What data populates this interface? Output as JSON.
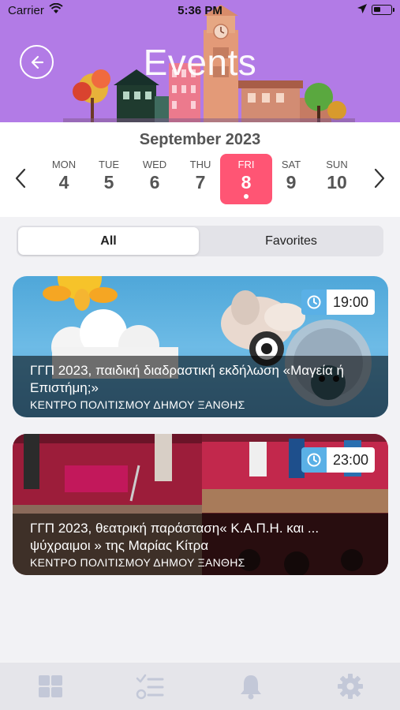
{
  "status": {
    "carrier": "Carrier",
    "time": "5:36 PM"
  },
  "header": {
    "title": "Events"
  },
  "calendar": {
    "month": "September 2023",
    "days": [
      {
        "name": "MON",
        "num": "4"
      },
      {
        "name": "TUE",
        "num": "5"
      },
      {
        "name": "WED",
        "num": "6"
      },
      {
        "name": "THU",
        "num": "7"
      },
      {
        "name": "FRI",
        "num": "8"
      },
      {
        "name": "SAT",
        "num": "9"
      },
      {
        "name": "SUN",
        "num": "10"
      }
    ],
    "selected_index": 4
  },
  "filter": {
    "all": "All",
    "favorites": "Favorites",
    "selected": "All"
  },
  "events": [
    {
      "time": "19:00",
      "title": "ΓΓΠ 2023, παιδική διαδραστική εκδήλωση «Μαγεία ή Επιστήμη;»",
      "venue": "ΚΕΝΤΡΟ ΠΟΛΙΤΙΣΜΟΥ ΔΗΜΟΥ ΞΑΝΘΗΣ"
    },
    {
      "time": "23:00",
      "title": "ΓΓΠ 2023, θεατρική παράσταση« Κ.Α.Π.Η. και ... ψύχραιμοι » της Μαρίας Κίτρα",
      "venue": "ΚΕΝΤΡΟ ΠΟΛΙΤΙΣΜΟΥ ΔΗΜΟΥ ΞΑΝΘΗΣ"
    }
  ],
  "tabbar": {
    "icons": [
      "grid-icon",
      "checklist-icon",
      "bell-icon",
      "gear-icon"
    ]
  },
  "colors": {
    "header": "#b27be6",
    "selected_day": "#ff5574",
    "badge_icon": "#5ab0e6",
    "tab_icon": "#c3c8d8"
  }
}
